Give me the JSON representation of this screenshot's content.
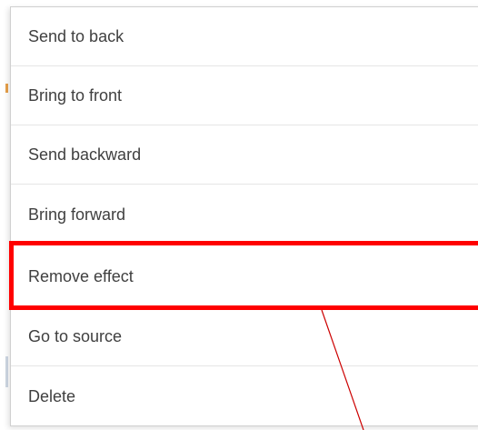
{
  "context_menu": {
    "items": [
      {
        "label": "Send to back"
      },
      {
        "label": "Bring to front"
      },
      {
        "label": "Send backward"
      },
      {
        "label": "Bring forward"
      },
      {
        "label": "Remove effect"
      },
      {
        "label": "Go to source"
      },
      {
        "label": "Delete"
      }
    ]
  },
  "annotation": {
    "highlighted_item": "Remove effect",
    "highlight_color": "#ff0000"
  }
}
